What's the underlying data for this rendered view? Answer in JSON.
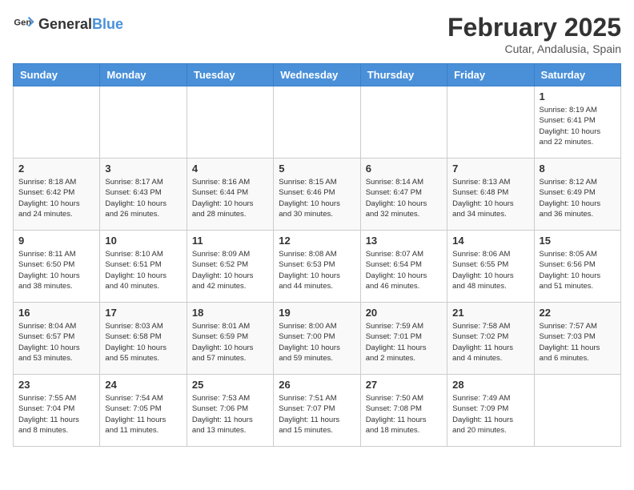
{
  "header": {
    "logo_general": "General",
    "logo_blue": "Blue",
    "month_title": "February 2025",
    "location": "Cutar, Andalusia, Spain"
  },
  "days_of_week": [
    "Sunday",
    "Monday",
    "Tuesday",
    "Wednesday",
    "Thursday",
    "Friday",
    "Saturday"
  ],
  "weeks": [
    {
      "days": [
        {
          "num": "",
          "info": ""
        },
        {
          "num": "",
          "info": ""
        },
        {
          "num": "",
          "info": ""
        },
        {
          "num": "",
          "info": ""
        },
        {
          "num": "",
          "info": ""
        },
        {
          "num": "",
          "info": ""
        },
        {
          "num": "1",
          "info": "Sunrise: 8:19 AM\nSunset: 6:41 PM\nDaylight: 10 hours\nand 22 minutes."
        }
      ]
    },
    {
      "days": [
        {
          "num": "2",
          "info": "Sunrise: 8:18 AM\nSunset: 6:42 PM\nDaylight: 10 hours\nand 24 minutes."
        },
        {
          "num": "3",
          "info": "Sunrise: 8:17 AM\nSunset: 6:43 PM\nDaylight: 10 hours\nand 26 minutes."
        },
        {
          "num": "4",
          "info": "Sunrise: 8:16 AM\nSunset: 6:44 PM\nDaylight: 10 hours\nand 28 minutes."
        },
        {
          "num": "5",
          "info": "Sunrise: 8:15 AM\nSunset: 6:46 PM\nDaylight: 10 hours\nand 30 minutes."
        },
        {
          "num": "6",
          "info": "Sunrise: 8:14 AM\nSunset: 6:47 PM\nDaylight: 10 hours\nand 32 minutes."
        },
        {
          "num": "7",
          "info": "Sunrise: 8:13 AM\nSunset: 6:48 PM\nDaylight: 10 hours\nand 34 minutes."
        },
        {
          "num": "8",
          "info": "Sunrise: 8:12 AM\nSunset: 6:49 PM\nDaylight: 10 hours\nand 36 minutes."
        }
      ]
    },
    {
      "days": [
        {
          "num": "9",
          "info": "Sunrise: 8:11 AM\nSunset: 6:50 PM\nDaylight: 10 hours\nand 38 minutes."
        },
        {
          "num": "10",
          "info": "Sunrise: 8:10 AM\nSunset: 6:51 PM\nDaylight: 10 hours\nand 40 minutes."
        },
        {
          "num": "11",
          "info": "Sunrise: 8:09 AM\nSunset: 6:52 PM\nDaylight: 10 hours\nand 42 minutes."
        },
        {
          "num": "12",
          "info": "Sunrise: 8:08 AM\nSunset: 6:53 PM\nDaylight: 10 hours\nand 44 minutes."
        },
        {
          "num": "13",
          "info": "Sunrise: 8:07 AM\nSunset: 6:54 PM\nDaylight: 10 hours\nand 46 minutes."
        },
        {
          "num": "14",
          "info": "Sunrise: 8:06 AM\nSunset: 6:55 PM\nDaylight: 10 hours\nand 48 minutes."
        },
        {
          "num": "15",
          "info": "Sunrise: 8:05 AM\nSunset: 6:56 PM\nDaylight: 10 hours\nand 51 minutes."
        }
      ]
    },
    {
      "days": [
        {
          "num": "16",
          "info": "Sunrise: 8:04 AM\nSunset: 6:57 PM\nDaylight: 10 hours\nand 53 minutes."
        },
        {
          "num": "17",
          "info": "Sunrise: 8:03 AM\nSunset: 6:58 PM\nDaylight: 10 hours\nand 55 minutes."
        },
        {
          "num": "18",
          "info": "Sunrise: 8:01 AM\nSunset: 6:59 PM\nDaylight: 10 hours\nand 57 minutes."
        },
        {
          "num": "19",
          "info": "Sunrise: 8:00 AM\nSunset: 7:00 PM\nDaylight: 10 hours\nand 59 minutes."
        },
        {
          "num": "20",
          "info": "Sunrise: 7:59 AM\nSunset: 7:01 PM\nDaylight: 11 hours\nand 2 minutes."
        },
        {
          "num": "21",
          "info": "Sunrise: 7:58 AM\nSunset: 7:02 PM\nDaylight: 11 hours\nand 4 minutes."
        },
        {
          "num": "22",
          "info": "Sunrise: 7:57 AM\nSunset: 7:03 PM\nDaylight: 11 hours\nand 6 minutes."
        }
      ]
    },
    {
      "days": [
        {
          "num": "23",
          "info": "Sunrise: 7:55 AM\nSunset: 7:04 PM\nDaylight: 11 hours\nand 8 minutes."
        },
        {
          "num": "24",
          "info": "Sunrise: 7:54 AM\nSunset: 7:05 PM\nDaylight: 11 hours\nand 11 minutes."
        },
        {
          "num": "25",
          "info": "Sunrise: 7:53 AM\nSunset: 7:06 PM\nDaylight: 11 hours\nand 13 minutes."
        },
        {
          "num": "26",
          "info": "Sunrise: 7:51 AM\nSunset: 7:07 PM\nDaylight: 11 hours\nand 15 minutes."
        },
        {
          "num": "27",
          "info": "Sunrise: 7:50 AM\nSunset: 7:08 PM\nDaylight: 11 hours\nand 18 minutes."
        },
        {
          "num": "28",
          "info": "Sunrise: 7:49 AM\nSunset: 7:09 PM\nDaylight: 11 hours\nand 20 minutes."
        },
        {
          "num": "",
          "info": ""
        }
      ]
    }
  ]
}
